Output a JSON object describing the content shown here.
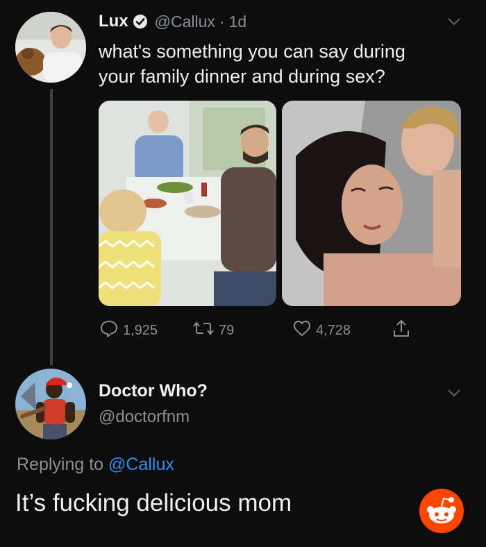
{
  "tweet": {
    "author_name": "Lux",
    "author_handle": "@Callux",
    "separator": "·",
    "time": "1d",
    "text_line1": "what's something you can say during",
    "text_line2": "your family dinner and during sex?",
    "stats": {
      "replies": "1,925",
      "retweets": "79",
      "likes": "4,728"
    }
  },
  "reply": {
    "author_name": "Doctor Who?",
    "author_handle": "@doctorfnm",
    "replying_prefix": "Replying to",
    "replying_mention": "@Callux",
    "text": "It’s fucking delicious mom"
  },
  "icons": [
    "verified-badge-icon",
    "chevron-down-icon",
    "reply-icon",
    "retweet-icon",
    "like-icon",
    "share-icon",
    "reddit-icon"
  ],
  "colors": {
    "background": "#0d0d0e",
    "mention": "#2f8ef0",
    "muted": "#8a9097",
    "reddit": "#ff4500"
  }
}
